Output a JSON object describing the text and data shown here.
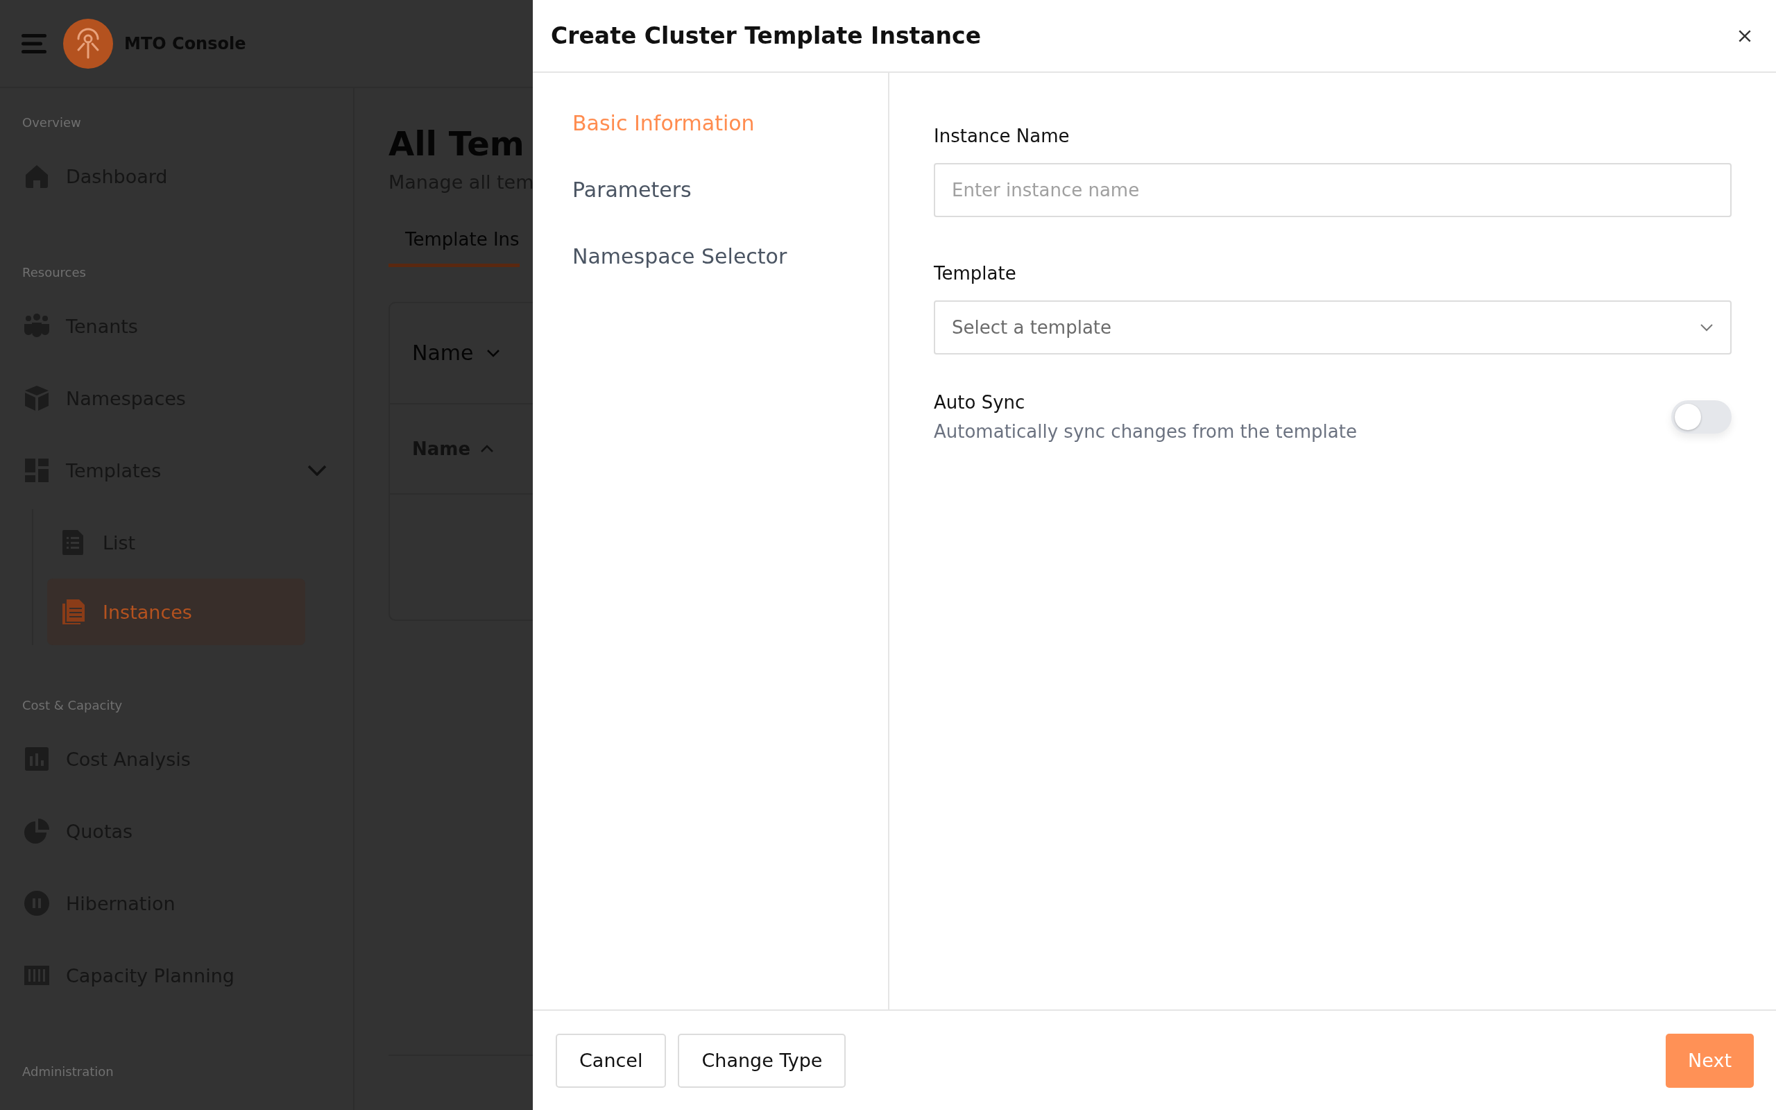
{
  "app_header": {
    "title": "MTO Console"
  },
  "sidebar": {
    "sections": [
      {
        "label": "Overview",
        "items": [
          {
            "label": "Dashboard",
            "kind": "home",
            "selected": false
          }
        ]
      },
      {
        "label": "Resources",
        "items": [
          {
            "label": "Tenants",
            "kind": "people",
            "selected": false
          },
          {
            "label": "Namespaces",
            "kind": "box",
            "selected": false
          },
          {
            "label": "Templates",
            "kind": "grid",
            "selected": false,
            "expanded": true,
            "children": [
              {
                "label": "List",
                "kind": "list",
                "selected": false
              },
              {
                "label": "Instances",
                "kind": "doc",
                "selected": true
              }
            ]
          }
        ]
      },
      {
        "label": "Cost & Capacity",
        "items": [
          {
            "label": "Cost Analysis",
            "kind": "chart",
            "selected": false
          },
          {
            "label": "Quotas",
            "kind": "pie",
            "selected": false
          },
          {
            "label": "Hibernation",
            "kind": "pause",
            "selected": false
          },
          {
            "label": "Capacity Planning",
            "kind": "bars",
            "selected": false
          }
        ]
      },
      {
        "label": "Administration"
      }
    ]
  },
  "main": {
    "title": "All Tem",
    "subtitle": "Manage all tem",
    "tabs": [
      {
        "label": "Template Ins",
        "selected": true
      }
    ],
    "filter": {
      "label": "Name"
    },
    "table": {
      "columns": [
        {
          "label": "Name",
          "sort_ascending": true
        }
      ]
    }
  },
  "dialog": {
    "title": "Create Cluster Template Instance",
    "steps": [
      {
        "label": "Basic Information",
        "selected": true
      },
      {
        "label": "Parameters",
        "selected": false
      },
      {
        "label": "Namespace Selector",
        "selected": false
      }
    ],
    "fields": [
      {
        "kind": "text",
        "label": "Instance Name",
        "placeholder": "Enter instance name"
      },
      {
        "kind": "select",
        "label": "Template",
        "placeholder": "Select a template"
      },
      {
        "kind": "toggle",
        "label": "Auto Sync",
        "description": "Automatically sync changes from the template",
        "on": false
      }
    ],
    "buttons": [
      {
        "label": "Cancel",
        "kind": "secondary"
      },
      {
        "label": "Change Type",
        "kind": "secondary"
      },
      {
        "label": "Next",
        "kind": "primary"
      }
    ]
  }
}
